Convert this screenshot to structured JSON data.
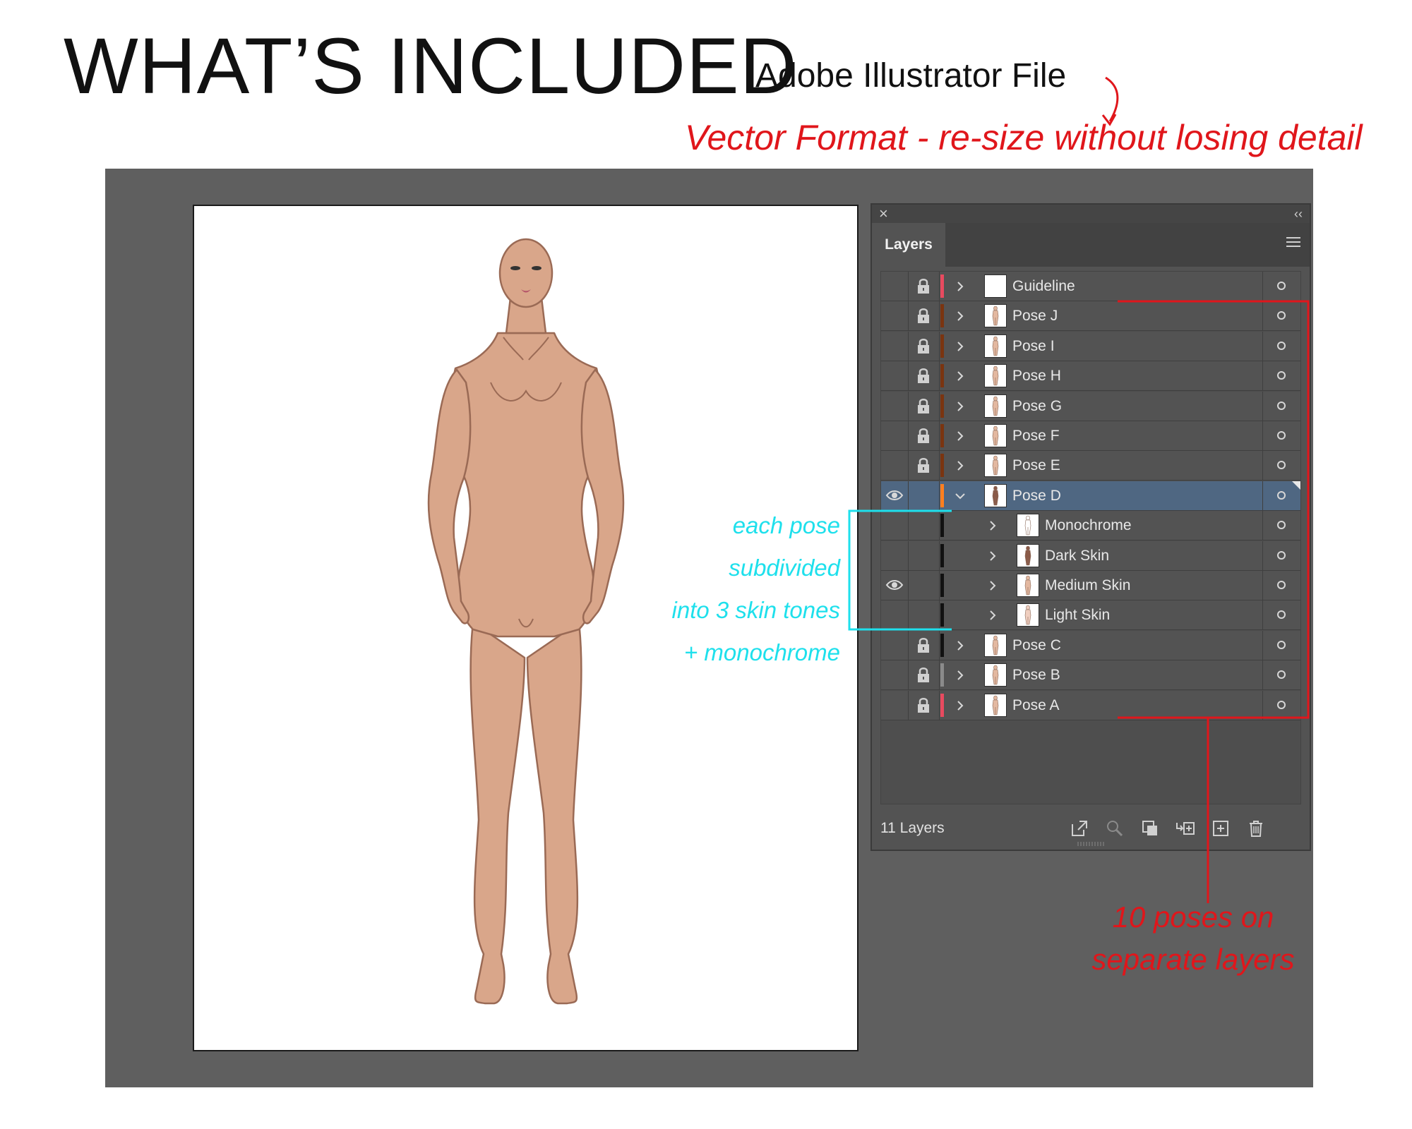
{
  "heading": "WHAT’S INCLUDED",
  "file_label": "Adobe Illustrator File",
  "vector_note": "Vector Format - re-size without losing detail",
  "panel": {
    "close_glyph": "×",
    "collapse_glyph": "‹‹",
    "tab_label": "Layers",
    "layer_count": "11 Layers",
    "rows": [
      {
        "label": "Guideline",
        "visible": false,
        "locked": true,
        "color": "#e84a5f",
        "indent": 0,
        "expanded": false,
        "thumb": "blank"
      },
      {
        "label": "Pose J",
        "visible": false,
        "locked": true,
        "color": "#7a3410",
        "indent": 0,
        "expanded": false,
        "thumb": "figure"
      },
      {
        "label": "Pose I",
        "visible": false,
        "locked": true,
        "color": "#7a3410",
        "indent": 0,
        "expanded": false,
        "thumb": "figure"
      },
      {
        "label": "Pose H",
        "visible": false,
        "locked": true,
        "color": "#7a3410",
        "indent": 0,
        "expanded": false,
        "thumb": "figure"
      },
      {
        "label": "Pose G",
        "visible": false,
        "locked": true,
        "color": "#7a3410",
        "indent": 0,
        "expanded": false,
        "thumb": "figure"
      },
      {
        "label": "Pose F",
        "visible": false,
        "locked": true,
        "color": "#7a3410",
        "indent": 0,
        "expanded": false,
        "thumb": "figure"
      },
      {
        "label": "Pose E",
        "visible": false,
        "locked": true,
        "color": "#7a3410",
        "indent": 0,
        "expanded": false,
        "thumb": "figure"
      },
      {
        "label": "Pose D",
        "visible": true,
        "locked": false,
        "color": "#ff7f1f",
        "indent": 0,
        "expanded": true,
        "thumb": "figure-dark",
        "selected": true
      },
      {
        "label": "Monochrome",
        "visible": false,
        "locked": false,
        "color": "#111111",
        "indent": 1,
        "expanded": false,
        "thumb": "mono"
      },
      {
        "label": "Dark Skin",
        "visible": false,
        "locked": false,
        "color": "#111111",
        "indent": 1,
        "expanded": false,
        "thumb": "figure-dark"
      },
      {
        "label": "Medium Skin",
        "visible": true,
        "locked": false,
        "color": "#111111",
        "indent": 1,
        "expanded": false,
        "thumb": "figure"
      },
      {
        "label": "Light Skin",
        "visible": false,
        "locked": false,
        "color": "#111111",
        "indent": 1,
        "expanded": false,
        "thumb": "figure-light"
      },
      {
        "label": "Pose C",
        "visible": false,
        "locked": true,
        "color": "#111111",
        "indent": 0,
        "expanded": false,
        "thumb": "figure"
      },
      {
        "label": "Pose B",
        "visible": false,
        "locked": true,
        "color": "#8a8a8a",
        "indent": 0,
        "expanded": false,
        "thumb": "figure"
      },
      {
        "label": "Pose A",
        "visible": false,
        "locked": true,
        "color": "#e84a5f",
        "indent": 0,
        "expanded": false,
        "thumb": "figure"
      }
    ],
    "footer_icons": [
      "export-icon",
      "locate-object-icon",
      "make-clipping-mask-icon",
      "create-sublayer-icon",
      "new-layer-icon",
      "delete-icon"
    ]
  },
  "annotations": {
    "cyan_lines": [
      "each pose subdivided",
      "into 3 skin tones",
      "+ monochrome"
    ],
    "red_lines": [
      "10 poses on",
      "separate layers"
    ],
    "cyan_color": "#1ee0ec",
    "red_color": "#e0161b"
  },
  "colors": {
    "skin": "#d9a68a",
    "skin_outline": "#9a6a55",
    "panel_bg": "#535353",
    "selected_row": "#4f6782"
  }
}
